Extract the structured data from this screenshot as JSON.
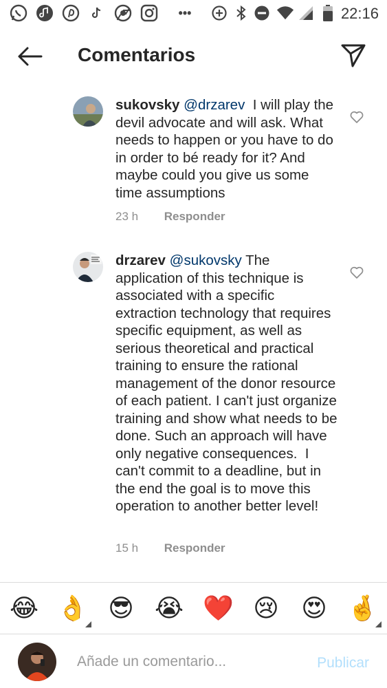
{
  "status_bar": {
    "time": "22:16",
    "more": "•••"
  },
  "header": {
    "title": "Comentarios"
  },
  "comments": [
    {
      "username": "sukovsky",
      "mention": "@drzarev",
      "text": "  I will play the devil advocate and will ask. What needs to happen or you have to do in order to bé ready for it? And maybe could you give us some time assumptions",
      "time": "23 h",
      "reply_label": "Responder"
    },
    {
      "username": "drzarev",
      "mention": "@sukovsky",
      "text": " The application of this technique is associated with a specific extraction technology that requires specific equipment, as well as serious theoretical and practical training to ensure the rational management of the donor resource of each patient. I can't just organize training and show what needs to be done. Such an approach will have only negative consequences.  I can't commit to a deadline, but in the end the goal is to move this operation to another better level!",
      "time": "15 h",
      "reply_label": "Responder"
    }
  ],
  "emoji_bar": [
    "😂",
    "👌",
    "😎",
    "😭",
    "❤️",
    "😢",
    "😍",
    "🤞"
  ],
  "input": {
    "placeholder": "Añade un comentario...",
    "value": "",
    "publish_label": "Publicar"
  },
  "colors": {
    "mention": "#00376b",
    "meta_gray": "#8e8e8e",
    "publish_disabled": "#b2dffc"
  }
}
